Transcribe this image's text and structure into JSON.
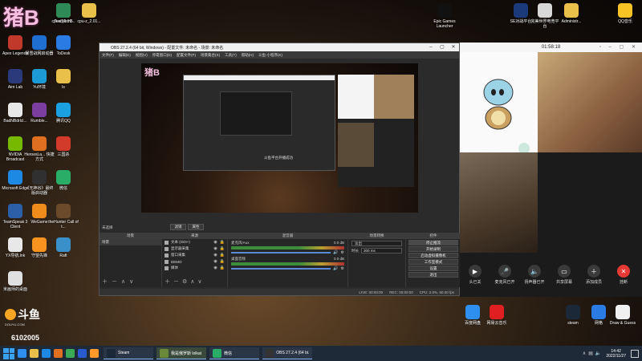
{
  "stream_logo": {
    "text": "猪B",
    "room_id": "6102005",
    "site": "DOUYU.COM"
  },
  "desktop_icons_left": [
    {
      "label": "Apex Legends",
      "color": "#c0392b"
    },
    {
      "label": "Aim Lab",
      "color": "#2a3a7a"
    },
    {
      "label": "BadNBdrlcl...",
      "color": "#e8e8e8"
    },
    {
      "label": "NVIDIA Broadcast",
      "color": "#76b900"
    },
    {
      "label": "Microsoft Edge",
      "color": "#1e88e5"
    },
    {
      "label": "TeamSpeak 3 Client",
      "color": "#2b5fa8"
    },
    {
      "label": "YX导航.lnk",
      "color": "#e8e8e8"
    },
    {
      "label": "米画师的桌面",
      "color": "#e0e0e0"
    }
  ],
  "desktop_icons_col2": [
    {
      "label": "暴雪战网启动器",
      "color": "#1f6fd0"
    },
    {
      "label": "Yu环境",
      "color": "#1c9ad6"
    },
    {
      "label": "Rumble...",
      "color": "#7b3fa0"
    },
    {
      "label": "HeroesLa... 快捷方式",
      "color": "#e07020"
    },
    {
      "label": "《无神谷》最终版启动器",
      "color": "#303030"
    },
    {
      "label": "WeGame",
      "color": "#f08c1c"
    },
    {
      "label": "守望先锋",
      "color": "#f7931e"
    }
  ],
  "desktop_icons_col3": [
    {
      "label": "ToDesk",
      "color": "#2a7be4"
    },
    {
      "label": "Is",
      "color": "#e8c04a"
    },
    {
      "label": "腾讯QQ",
      "color": "#1ba1e2"
    },
    {
      "label": "三国杀",
      "color": "#d23a2a"
    },
    {
      "label": "微信",
      "color": "#2aae67"
    },
    {
      "label": "theHunter Call of t...",
      "color": "#6a4a2a"
    },
    {
      "label": "Raft",
      "color": "#3a90c8"
    }
  ],
  "desktop_icons_top": [
    {
      "label": "TestMem5",
      "color": "#2e8b57"
    },
    {
      "label": "cpu-z_2.01...",
      "color": "#e8c04a"
    }
  ],
  "desktop_icons_right": [
    {
      "label": "Epic Games Launcher",
      "color": "#111111"
    },
    {
      "label": "SE对战平台",
      "color": "#1a3a7a"
    },
    {
      "label": "完美世界电竞平台",
      "color": "#d8d8d8"
    },
    {
      "label": "Administr...",
      "color": "#e8c04a"
    },
    {
      "label": "QQ音乐",
      "color": "#f7c325"
    },
    {
      "label": "百度网盘",
      "color": "#2f8ff0"
    },
    {
      "label": "网易云音乐",
      "color": "#e02020"
    },
    {
      "label": "steam",
      "color": "#1b2838"
    },
    {
      "label": "网格",
      "color": "#2a7be4"
    },
    {
      "label": "Draw & Guess",
      "color": "#f0f0f0"
    }
  ],
  "obs": {
    "title": "OBS 27.2.4 (64 bit, Windows) - 配置文件: 未命名 - 场景: 未命名",
    "menu": [
      "文件(F)",
      "编辑(E)",
      "视图(V)",
      "停靠窗口(D)",
      "配置文件(P)",
      "场景集合(S)",
      "工具(T)",
      "帮助(H)",
      "斗鱼-小程序(K)"
    ],
    "transition_hint": "未选择",
    "tabs": {
      "filters": "滤镜",
      "properties": "属性"
    },
    "docks": {
      "scenes": "场景",
      "sources": "来源",
      "mixer": "混音器",
      "transitions": "场景转换",
      "controls": "控件"
    },
    "scenes": [
      "场景"
    ],
    "sources": [
      "文本 (GDI+)",
      "显示器采集",
      "窗口采集",
      "DEMO",
      "媒体"
    ],
    "mixer": [
      {
        "name": "麦克风/Aux",
        "db": "0.0 dB"
      },
      {
        "name": "桌面音频",
        "db": "0.0 dB"
      }
    ],
    "transition": {
      "type": "淡出",
      "duration_label": "时长",
      "duration_value": "300 ms"
    },
    "controls": [
      "停止推流",
      "开始录制",
      "启动虚拟摄像机",
      "工作室模式",
      "设置",
      "退出"
    ],
    "status": [
      "LIVE: 00:00:00",
      "REC: 00:00:00",
      "CPU: 2.0%, 60.00 fps"
    ],
    "notification": "斗鱼平台开播成功"
  },
  "call": {
    "timer": "01:58:18",
    "buttons": [
      {
        "label": "头已关",
        "icon": "camera-off-icon"
      },
      {
        "label": "麦克风已开",
        "icon": "mic-icon"
      },
      {
        "label": "扬声器已开",
        "icon": "speaker-icon"
      },
      {
        "label": "共享屏幕",
        "icon": "screen-share-icon"
      },
      {
        "label": "添加成员",
        "icon": "add-member-icon"
      },
      {
        "label": "挂断",
        "icon": "hangup-icon"
      }
    ]
  },
  "taskbar": {
    "apps": [
      {
        "label": "Steam",
        "color": "#1b2838"
      },
      {
        "label": "我是俄罗斯 lolkat",
        "color": "#6a8a3a"
      },
      {
        "label": "微信",
        "color": "#2aae67"
      },
      {
        "label": "OBS 27.2.4 (64 bi...",
        "color": "#333333"
      }
    ],
    "pinned_colors": [
      "#2f8ff0",
      "#e8c04a",
      "#1e88e5",
      "#e07020",
      "#3aaa55",
      "#2a5ad0",
      "#ff9a2a"
    ],
    "time": "14:42",
    "date": "2022/11/27"
  }
}
